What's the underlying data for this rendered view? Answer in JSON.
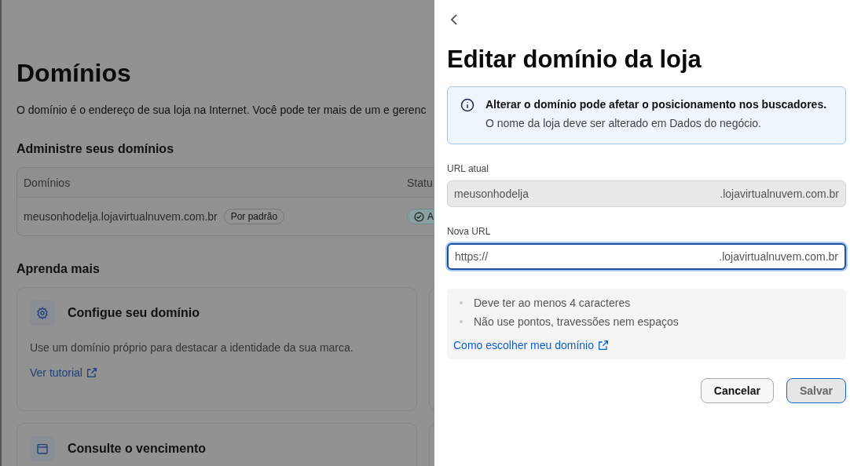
{
  "page": {
    "title": "Domínios",
    "description": "O domínio é o endereço de sua loja na Internet. Você pode ter mais de um e gerenc",
    "section_title": "Administre seus domínios",
    "table": {
      "columns": [
        "Domínios",
        "Statu"
      ],
      "rows": [
        {
          "domain": "meusonhodelja.lojavirtualnuvem.com.br",
          "badge": "Por padrão",
          "status": "A"
        }
      ]
    },
    "learn_title": "Aprenda mais",
    "cards": [
      {
        "kind": "gear",
        "title": "Configue seu domínio",
        "text": "Use um domínio próprio para destacar a identidade da sua marca.",
        "link": "Ver tutorial"
      },
      {
        "kind": "calendar",
        "title": "Consulte o vencimento"
      }
    ]
  },
  "drawer": {
    "title": "Editar domínio da loja",
    "alert": {
      "title": "Alterar o domínio pode afetar o posicionamento nos buscadores.",
      "text": "O nome da loja deve ser alterado em Dados do negócio."
    },
    "fields": [
      {
        "label": "URL atual",
        "value": "meusonhodelja",
        "suffix": ".lojavirtualnuvem.com.br",
        "disabled": true,
        "focused": false
      },
      {
        "label": "Nova URL",
        "value": "https://",
        "suffix": ".lojavirtualnuvem.com.br",
        "disabled": false,
        "focused": true
      }
    ],
    "hints": [
      "Deve ter ao menos 4 caracteres",
      "Não use pontos, travessões nem espaços"
    ],
    "help_link": "Como escolher meu domínio",
    "buttons": [
      {
        "label": "Cancelar",
        "kind": "secondary",
        "disabled": false
      },
      {
        "label": "Salvar",
        "kind": "primary",
        "disabled": true
      }
    ]
  }
}
